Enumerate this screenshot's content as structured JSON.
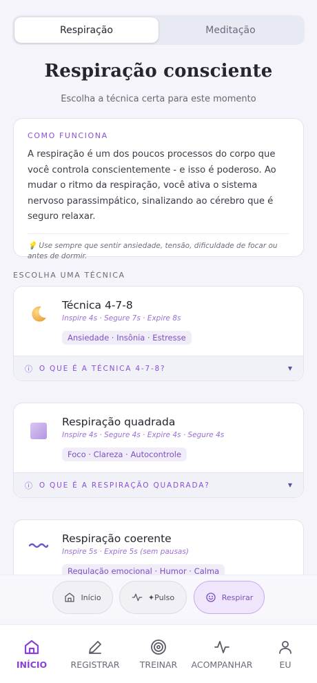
{
  "tabs": [
    {
      "label": "Respiração",
      "active": true
    },
    {
      "label": "Meditação",
      "active": false
    }
  ],
  "header": {
    "title": "Respiração consciente",
    "subtitle": "Escolha a técnica certa para este momento"
  },
  "how_it_works": {
    "label": "COMO FUNCIONA",
    "text": "A respiração é um dos poucos processos do corpo que você controla conscientemente - e isso é poderoso. Ao mudar o ritmo da respiração, você ativa o sistema nervoso parassimpático, sinalizando ao cérebro que é seguro relaxar.",
    "tip_icon": "💡",
    "tip": "Use sempre que sentir ansiedade, tensão, dificuldade de focar ou antes de dormir."
  },
  "section_label": "ESCOLHA UMA TÉCNICA",
  "techniques": [
    {
      "icon": "moon-icon",
      "name": "Técnica 4-7-8",
      "steps": "Inspire 4s · Segure 7s · Expire 8s",
      "tags": "Ansiedade · Insônia · Estresse",
      "expand_label": "O QUE É A TÉCNICA 4-7-8?"
    },
    {
      "icon": "square-icon",
      "name": "Respiração quadrada",
      "steps": "Inspire 4s · Segure 4s · Expire 4s · Segure 4s",
      "tags": "Foco · Clareza · Autocontrole",
      "expand_label": "O QUE É A RESPIRAÇÃO QUADRADA?"
    },
    {
      "icon": "wave-icon",
      "name": "Respiração coerente",
      "steps": "Inspire 5s · Expire 5s (sem pausas)",
      "tags": "Regulação emocional · Humor · Calma"
    }
  ],
  "quick_actions": [
    {
      "label": "Início",
      "icon": "home-icon",
      "active": false
    },
    {
      "label": "✦Pulso",
      "icon": "pulse-icon",
      "active": false
    },
    {
      "label": "Respirar",
      "icon": "smile-icon",
      "active": true
    }
  ],
  "nav": [
    {
      "label": "INÍCIO",
      "icon": "home-icon",
      "active": true
    },
    {
      "label": "REGISTRAR",
      "icon": "pencil-icon",
      "active": false
    },
    {
      "label": "TREINAR",
      "icon": "target-icon",
      "active": false
    },
    {
      "label": "ACOMPANHAR",
      "icon": "activity-icon",
      "active": false
    },
    {
      "label": "EU",
      "icon": "user-icon",
      "active": false
    }
  ],
  "colors": {
    "accent": "#8a3fd6",
    "background": "#f4f4fa"
  }
}
